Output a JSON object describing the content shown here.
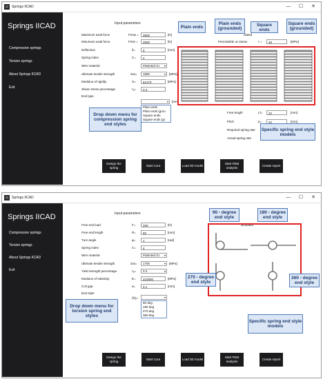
{
  "window_title": "Springs IICAD",
  "window_controls": {
    "minimize": "—",
    "maximize": "☐",
    "close": "✕"
  },
  "app_title": "Springs IICAD",
  "sidebar": [
    {
      "label": "Compressive springs"
    },
    {
      "label": "Torsion springs"
    },
    {
      "label": "About Springs IICAD"
    },
    {
      "label": "Exit"
    }
  ],
  "buttons": [
    {
      "label": "Design the spring"
    },
    {
      "label": "Start Cura"
    },
    {
      "label": "Load 3D model"
    },
    {
      "label": "Start FEM analysis"
    },
    {
      "label": "Create report"
    }
  ],
  "top": {
    "input_heading": "Input parameters",
    "rows": [
      {
        "label": "Maximum axial force",
        "sym": "Fmax =",
        "value": "3500",
        "unit": "[N]"
      },
      {
        "label": "Minumum axial force",
        "sym": "Fmin =",
        "value": "2500",
        "unit": "[N]"
      },
      {
        "label": "Deflection",
        "sym": "δ=",
        "value": "5",
        "unit": "[mm]"
      },
      {
        "label": "Spring index",
        "sym": "C=",
        "value": "4",
        "unit": ""
      },
      {
        "label": "Wire material",
        "sym": "",
        "value": "Patented Gr",
        "unit": ""
      },
      {
        "label": "Ultimate tensile strength",
        "sym": "Sut=",
        "value": "1650",
        "unit": "[MPa]"
      },
      {
        "label": "Modulus of rigidity",
        "sym": "G=",
        "value": "81370",
        "unit": "[MPa]"
      },
      {
        "label": "Shear stress percentage",
        "sym": "τₐ=",
        "value": "0.3",
        "unit": ""
      },
      {
        "label": "End type",
        "sym": "",
        "value": "",
        "unit": ""
      }
    ],
    "dropdown_options": [
      "Plain ends",
      "Plain ends (grou",
      "Square ends",
      "Square ends (gr"
    ],
    "extra_unit": "[mm]",
    "results_heading": "ulated",
    "results": [
      {
        "label": "Permissible",
        "sym": "",
        "value": "",
        "unit": ""
      },
      {
        "label": "ar stress",
        "sym": "τ =",
        "value": "49",
        "unit": "[MPa]"
      },
      {
        "label": "Free length",
        "sym": "Lf=",
        "value": "22",
        "unit": "[mm]"
      },
      {
        "label": "Pitch",
        "sym": "p=",
        "value": "22",
        "unit": "[mm]"
      },
      {
        "label": "Required spring rate",
        "sym": "",
        "value": "",
        "unit": ""
      },
      {
        "label": "Actual spring rate",
        "sym": "",
        "value": "",
        "unit": ""
      }
    ],
    "callouts": {
      "plain_ends": "Plain ends",
      "plain_ends_grounded": "Plain ends (grounded)",
      "square_ends": "Square ends",
      "square_ends_grounded": "Square ends (grounded)",
      "dropdown_note": "Drop down menu for compression spring end styles",
      "models_note": "Specific spring end style models"
    }
  },
  "bottom": {
    "input_heading": "Input parameters",
    "rows": [
      {
        "label": "Free end load",
        "sym": "F=",
        "value": "200",
        "unit": "[N]"
      },
      {
        "label": "Free end length",
        "sym": "R=",
        "value": "50",
        "unit": "[mm]"
      },
      {
        "label": "Turn angle",
        "sym": "φ=",
        "value": "1",
        "unit": "[rad]"
      },
      {
        "label": "Spring index",
        "sym": "C=",
        "value": "4",
        "unit": ""
      },
      {
        "label": "Wire material",
        "sym": "",
        "value": "Patented Gr",
        "unit": ""
      },
      {
        "label": "Ultimate tensile strength",
        "sym": "Sut=",
        "value": "1700",
        "unit": "[MPa]"
      },
      {
        "label": "Yield strength percentage",
        "sym": "τₐ=",
        "value": "0.3",
        "unit": ""
      },
      {
        "label": "Modulus of elasticity",
        "sym": "E=",
        "value": "210000",
        "unit": "[MPa]"
      },
      {
        "label": "Coil gap",
        "sym": "a=",
        "value": "0.1",
        "unit": "[mm]"
      },
      {
        "label": "End style",
        "sym": "",
        "value": "",
        "unit": ""
      }
    ],
    "dropdown_options": [
      "90 deg",
      "180 deg",
      "270 deg",
      "360 deg"
    ],
    "extra_sym": "(fs)=",
    "results_heading": "alculated",
    "callouts": {
      "deg90": "90 - degree end style",
      "deg180": "180 - degree end style",
      "deg270": "270 - degree end style",
      "deg360": "360 - degree end style",
      "dropdown_note": "Drop down menu for torsion spring end styles",
      "models_note": "Specific spring end style models"
    }
  },
  "colors": {
    "sidebar": "#1c1b1e",
    "red_box": "#e02020",
    "callout_bg": "#dbe7f6",
    "callout_border": "#4f79b8"
  }
}
